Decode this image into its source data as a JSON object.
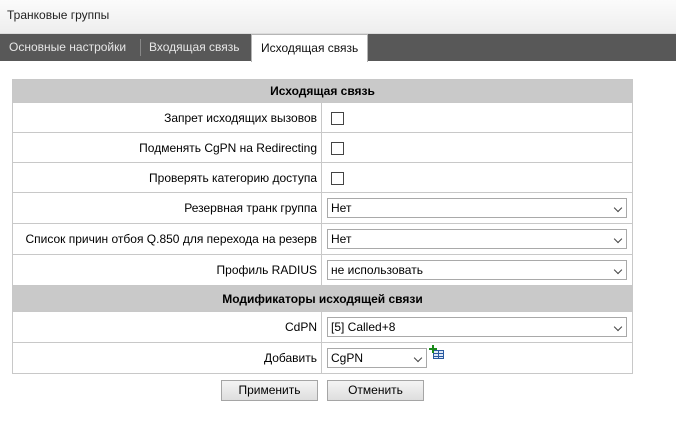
{
  "window": {
    "title": "Транковые группы"
  },
  "tabs": [
    {
      "label": "Основные настройки"
    },
    {
      "label": "Входящая связь"
    },
    {
      "label": "Исходящая связь"
    }
  ],
  "outgoing": {
    "header": "Исходящая связь",
    "rows": {
      "bar_calls": {
        "label": "Запрет исходящих вызовов",
        "checked": false
      },
      "replace_cgpn": {
        "label": "Подменять CgPN на Redirecting",
        "checked": false
      },
      "check_category": {
        "label": "Проверять категорию доступа",
        "checked": false
      },
      "reserve_group": {
        "label": "Резервная транк группа",
        "value": "Нет"
      },
      "q850_causes": {
        "label": "Список причин отбоя Q.850 для перехода на резерв",
        "value": "Нет"
      },
      "radius_profile": {
        "label": "Профиль RADIUS",
        "value": "не использовать"
      }
    }
  },
  "modifiers": {
    "header": "Модификаторы исходящей связи",
    "cdpn": {
      "label": "CdPN",
      "value": "[5] Called+8"
    },
    "add": {
      "label": "Добавить",
      "value": "CgPN"
    }
  },
  "buttons": {
    "apply": "Применить",
    "cancel": "Отменить"
  }
}
